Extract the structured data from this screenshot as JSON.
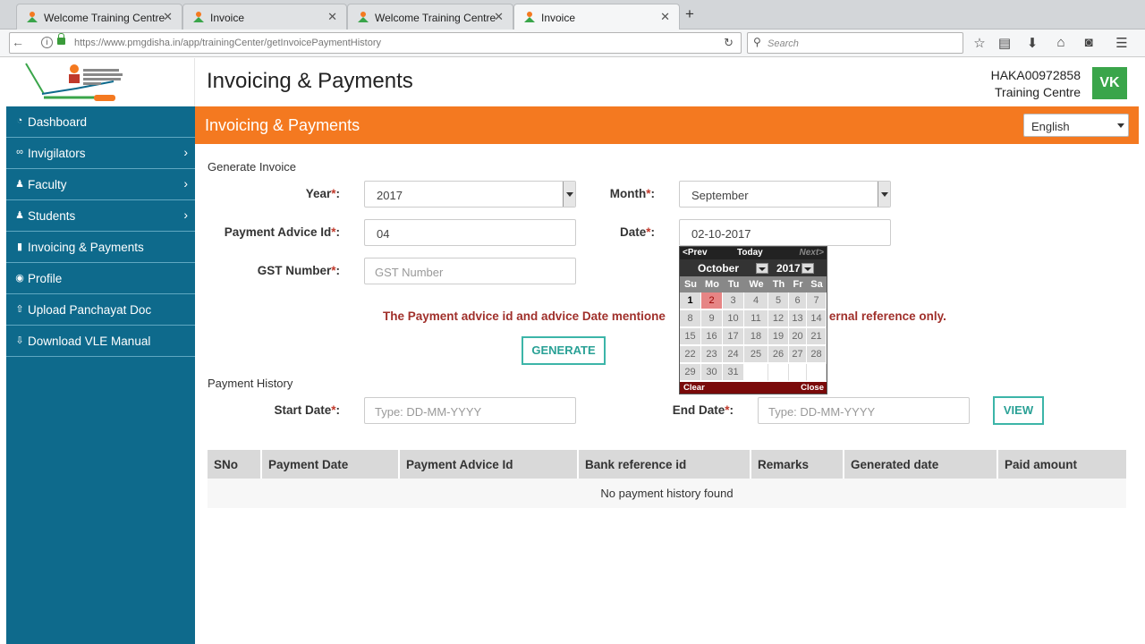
{
  "browser": {
    "tabs": [
      {
        "label": "Welcome Training Centre",
        "active": false
      },
      {
        "label": "Invoice",
        "active": false
      },
      {
        "label": "Welcome Training Centre",
        "active": false
      },
      {
        "label": "Invoice",
        "active": true
      }
    ],
    "url": "https://www.pmgdisha.in/app/trainingCenter/getInvoicePaymentHistory",
    "search_placeholder": "Search"
  },
  "header": {
    "title": "Invoicing & Payments",
    "center_id": "HAKA00972858",
    "center_type": "Training Centre",
    "avatar_initials": "VK"
  },
  "sidebar": {
    "items": [
      {
        "label": "Dashboard",
        "icon": "dashboard-icon",
        "has_submenu": false
      },
      {
        "label": "Invigilators",
        "icon": "binoculars-icon",
        "has_submenu": true
      },
      {
        "label": "Faculty",
        "icon": "users-icon",
        "has_submenu": true
      },
      {
        "label": "Students",
        "icon": "group-icon",
        "has_submenu": true
      },
      {
        "label": "Invoicing & Payments",
        "icon": "book-icon",
        "has_submenu": false
      },
      {
        "label": "Profile",
        "icon": "user-circle-icon",
        "has_submenu": false
      },
      {
        "label": "Upload Panchayat Doc",
        "icon": "upload-icon",
        "has_submenu": false
      },
      {
        "label": "Download VLE Manual",
        "icon": "download-icon",
        "has_submenu": false
      }
    ]
  },
  "banner": {
    "title": "Invoicing & Payments",
    "language": "English"
  },
  "generate_invoice": {
    "section_label": "Generate Invoice",
    "year_label": "Year",
    "year_value": "2017",
    "month_label": "Month",
    "month_value": "September",
    "advice_label": "Payment Advice Id",
    "advice_value": "04",
    "date_label": "Date",
    "date_value": "02-10-2017",
    "gst_label": "GST Number",
    "gst_placeholder": "GST Number",
    "required_mark": "*",
    "colon": ":",
    "notice_left": "The Payment advice id and advice Date mentione",
    "notice_right": "ernal reference only.",
    "generate_label": "GENERATE"
  },
  "payment_history": {
    "section_label": "Payment History",
    "start_label": "Start Date",
    "start_placeholder": "Type: DD-MM-YYYY",
    "end_label": "End Date",
    "end_placeholder": "Type: DD-MM-YYYY",
    "view_label": "VIEW",
    "columns": [
      "SNo",
      "Payment Date",
      "Payment Advice Id",
      "Bank reference id",
      "Remarks",
      "Generated date",
      "Paid amount"
    ],
    "empty_message": "No payment history found"
  },
  "datepicker": {
    "prev": "<Prev",
    "today": "Today",
    "next": "Next>",
    "month": "October",
    "year": "2017",
    "day_names": [
      "Su",
      "Mo",
      "Tu",
      "We",
      "Th",
      "Fr",
      "Sa"
    ],
    "weeks": [
      [
        "1",
        "2",
        "3",
        "4",
        "5",
        "6",
        "7"
      ],
      [
        "8",
        "9",
        "10",
        "11",
        "12",
        "13",
        "14"
      ],
      [
        "15",
        "16",
        "17",
        "18",
        "19",
        "20",
        "21"
      ],
      [
        "22",
        "23",
        "24",
        "25",
        "26",
        "27",
        "28"
      ],
      [
        "29",
        "30",
        "31",
        "",
        "",
        "",
        ""
      ]
    ],
    "today_day": "1",
    "selected_day": "2",
    "clear": "Clear",
    "close": "Close"
  }
}
